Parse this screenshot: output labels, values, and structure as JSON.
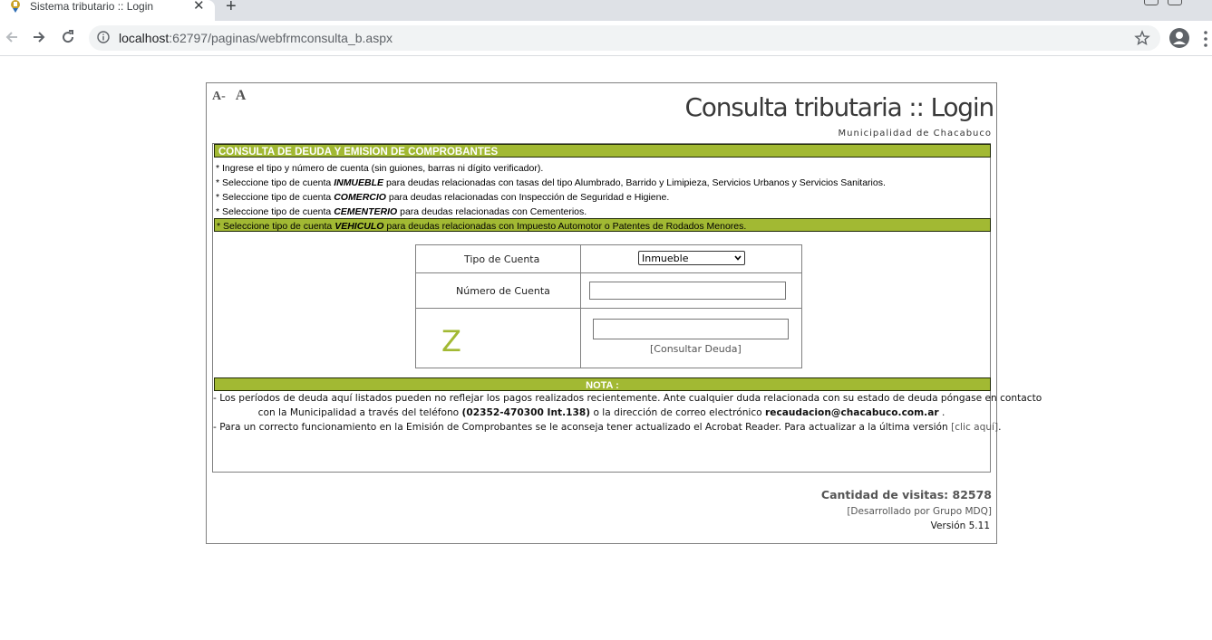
{
  "browser": {
    "tab_title": "Sistema tributario :: Login",
    "tab_close": "✕",
    "new_tab": "+",
    "url_host": "localhost",
    "url_path": ":62797/paginas/webfrmconsulta_b.aspx"
  },
  "page": {
    "font_small": "A-",
    "font_normal": "A",
    "title": "Consulta tributaria :: Login",
    "subtitle": "Municipalidad de Chacabuco",
    "accent_color": "#a2b933"
  },
  "instructions": {
    "header": "CONSULTA DE DEUDA Y EMISION DE COMPROBANTES",
    "line1": "* Ingrese el tipo y número de cuenta (sin guiones, barras ni dígito verificador).",
    "line2_pre": "* Seleccione tipo de cuenta ",
    "line2_em": "INMUEBLE",
    "line2_post": " para deudas relacionadas con tasas del tipo Alumbrado, Barrido y Limipieza, Servicios Urbanos y Servicios Sanitarios.",
    "line3_pre": "* Seleccione tipo de cuenta ",
    "line3_em": "COMERCIO",
    "line3_post": " para deudas relacionadas con Inspección de Seguridad e Higiene.",
    "line4_pre": "* Seleccione tipo de cuenta ",
    "line4_em": "CEMENTERIO",
    "line4_post": " para deudas relacionadas con Cementerios.",
    "line5_pre": "* Seleccione tipo de cuenta ",
    "line5_em": "VEHICULO",
    "line5_post": " para deudas relacionadas con Impuesto Automotor o Patentes de Rodados Menores."
  },
  "form": {
    "account_type_label": "Tipo de Cuenta",
    "account_type_value": "Inmueble",
    "account_number_label": "Número de Cuenta",
    "account_number_value": "",
    "captcha_text": "Z",
    "captcha_value": "",
    "submit_label": "[Consultar Deuda]"
  },
  "nota": {
    "header": "NOTA :",
    "line1": "- Los períodos de deuda aquí listados pueden no reflejar los pagos realizados recientemente. Ante cualquier duda relacionada con su estado de deuda  póngase en contacto",
    "line2_pre": "con la Municipalidad a través del teléfono ",
    "phone": "(02352-470300 Int.138)",
    "line2_mid": "  o la dirección de correo electrónico ",
    "email": "recaudacion@chacabuco.com.ar",
    "line2_post": " .",
    "line3_pre": "- Para un correcto funcionamiento en la Emisión de Comprobantes se le aconseja tener actualizado el Acrobat Reader. Para actualizar a la última versión ",
    "link": "[clic aquí]",
    "line3_post": "."
  },
  "footer": {
    "visits": "Cantidad de visitas: 82578",
    "developer": "[Desarrollado por Grupo MDQ]",
    "version": "Versión 5.11"
  }
}
